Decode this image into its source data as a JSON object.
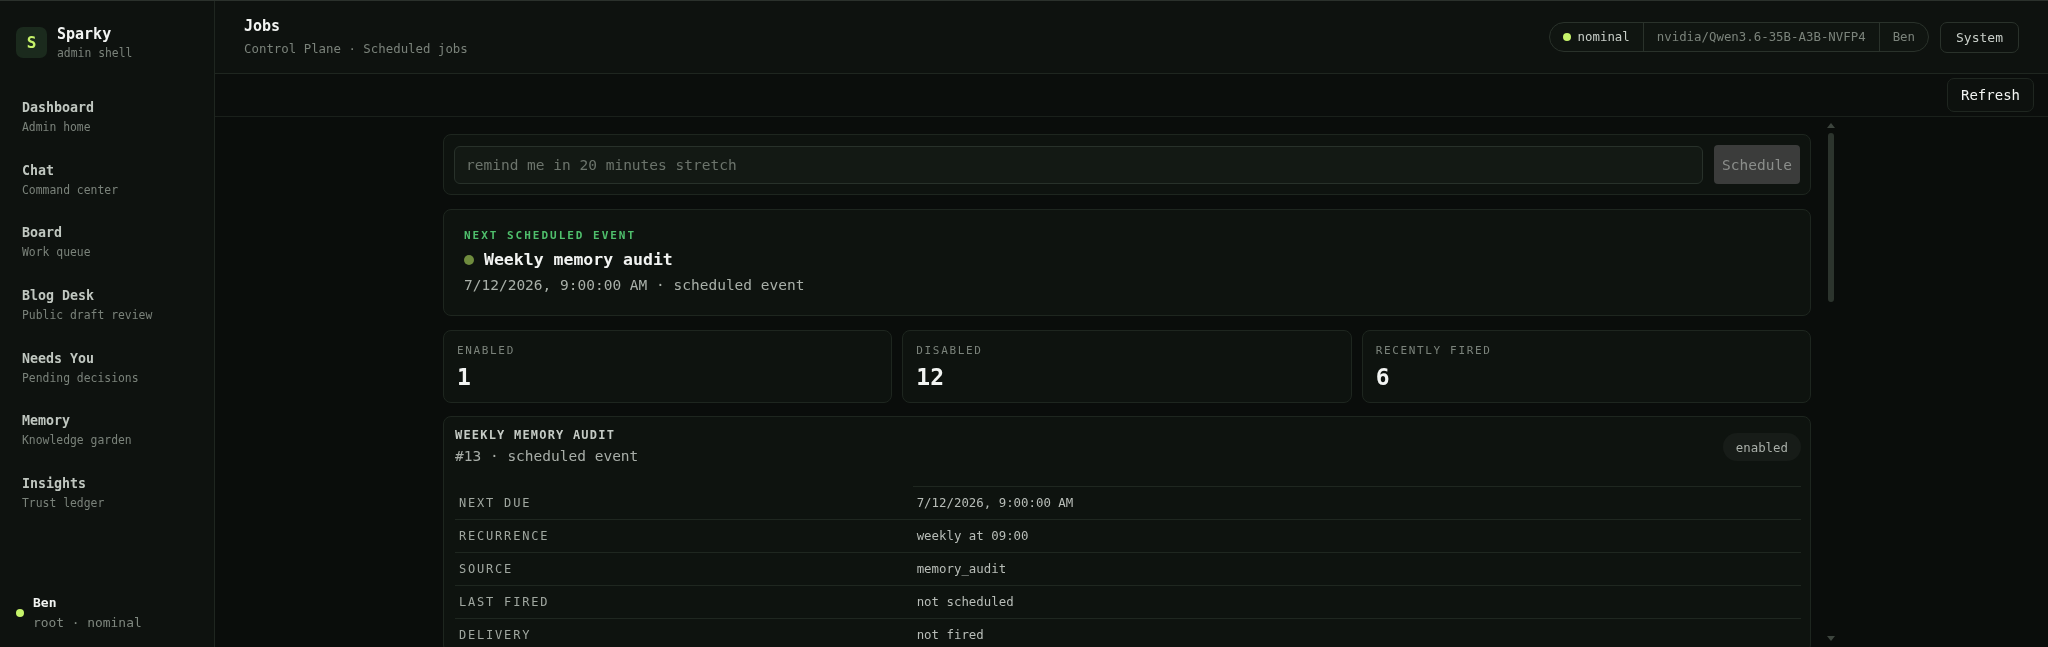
{
  "sidebar": {
    "brand": {
      "initial": "S",
      "name": "Sparky",
      "subtitle": "admin shell"
    },
    "items": [
      {
        "title": "Dashboard",
        "subtitle": "Admin home",
        "selected": false
      },
      {
        "title": "Chat",
        "subtitle": "Command center",
        "selected": false
      },
      {
        "title": "Board",
        "subtitle": "Work queue",
        "selected": false
      },
      {
        "title": "Blog Desk",
        "subtitle": "Public draft review",
        "selected": false
      },
      {
        "title": "Needs You",
        "subtitle": "Pending decisions",
        "selected": false
      },
      {
        "title": "Memory",
        "subtitle": "Knowledge garden",
        "selected": false
      },
      {
        "title": "Insights",
        "subtitle": "Trust ledger",
        "selected": false
      }
    ],
    "user": {
      "name": "Ben",
      "detail": "root · nominal"
    }
  },
  "header": {
    "title": "Jobs",
    "breadcrumb": "Control Plane · Scheduled jobs",
    "status_pill": {
      "status": "nominal",
      "model": "nvidia/Qwen3.6-35B-A3B-NVFP4",
      "user": "Ben"
    },
    "button": "System"
  },
  "toolbar": {
    "button": "Refresh"
  },
  "schedule_form": {
    "placeholder": "remind me in 20 minutes stretch",
    "button": {
      "label": "Schedule",
      "disabled": true
    }
  },
  "next_event": {
    "label": "NEXT SCHEDULED EVENT",
    "title": "Weekly memory audit",
    "meta": "7/12/2026, 9:00:00 AM · scheduled event"
  },
  "stats": [
    {
      "label": "ENABLED",
      "value": "1"
    },
    {
      "label": "DISABLED",
      "value": "12"
    },
    {
      "label": "RECENTLY FIRED",
      "value": "6"
    }
  ],
  "job": {
    "title": "WEEKLY MEMORY AUDIT",
    "subtitle": "#13 · scheduled event",
    "status": "enabled",
    "details": [
      {
        "label": "NEXT DUE",
        "value": "7/12/2026, 9:00:00 AM"
      },
      {
        "label": "RECURRENCE",
        "value": "weekly at 09:00"
      },
      {
        "label": "SOURCE",
        "value": "memory_audit"
      },
      {
        "label": "LAST FIRED",
        "value": "not scheduled"
      },
      {
        "label": "DELIVERY",
        "value": "not fired"
      }
    ]
  }
}
